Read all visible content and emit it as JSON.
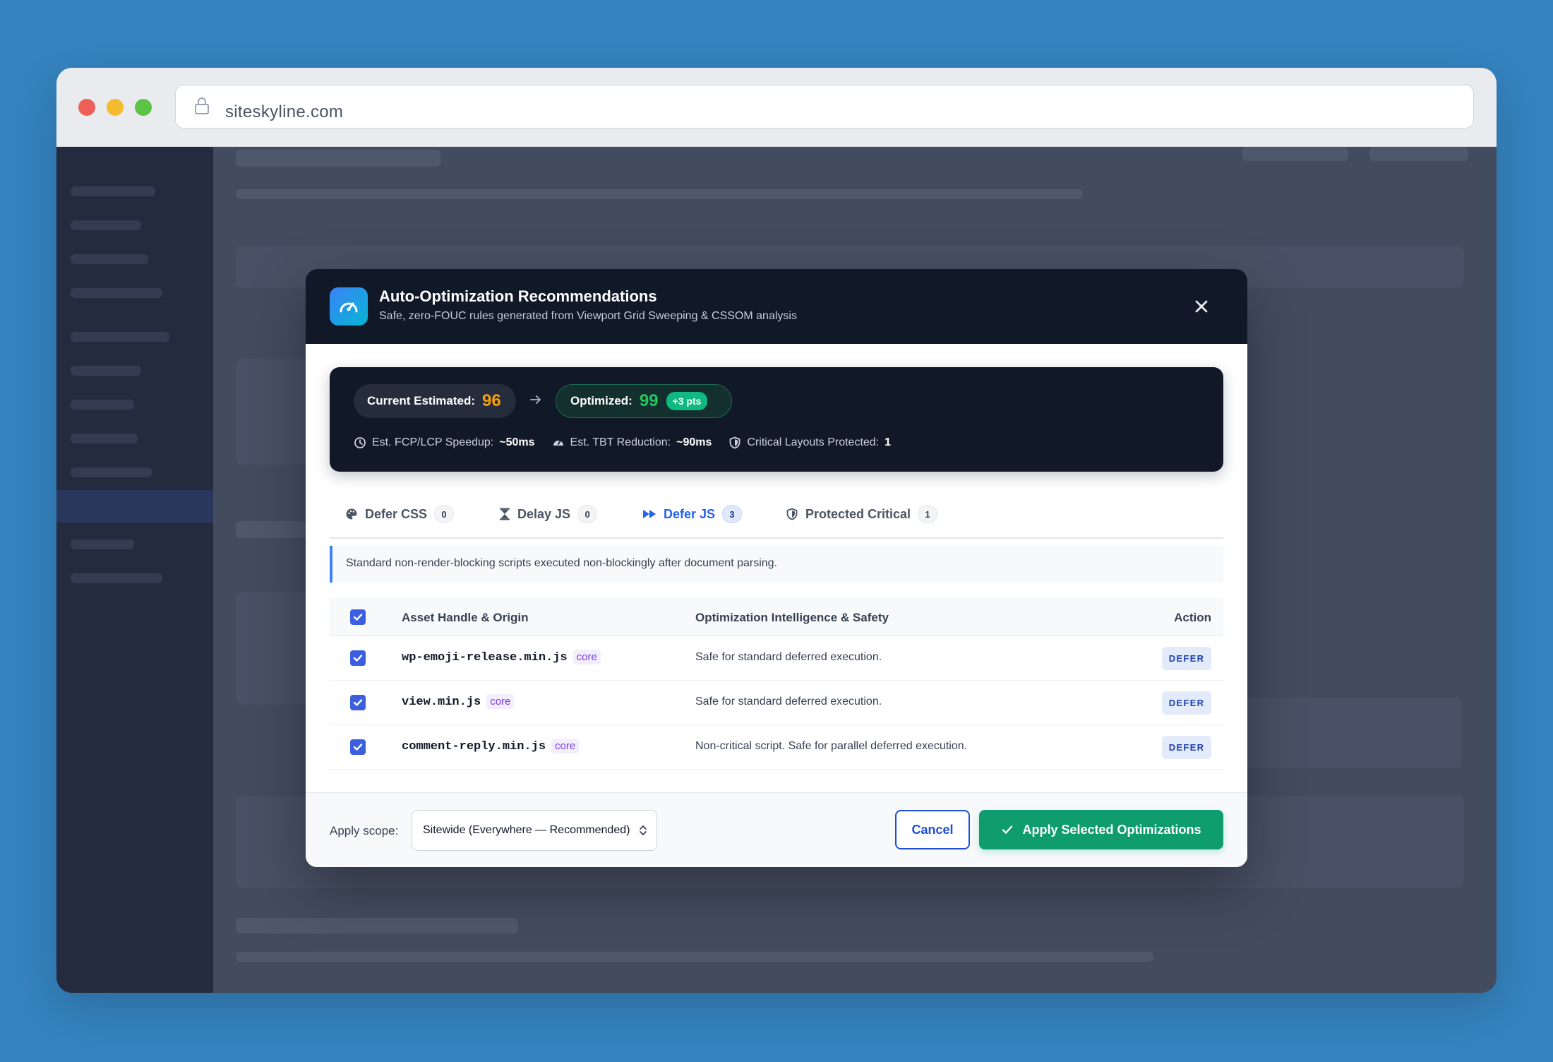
{
  "browser": {
    "url": "siteskyline.com"
  },
  "modal": {
    "title": "Auto-Optimization Recommendations",
    "subtitle": "Safe, zero-FOUC rules generated from Viewport Grid Sweeping & CSSOM analysis",
    "scores": {
      "current_label": "Current Estimated:",
      "current_value": "96",
      "optimized_label": "Optimized:",
      "optimized_value": "99",
      "delta": "+3 pts"
    },
    "metrics": [
      {
        "label": "Est. FCP/LCP Speedup:",
        "value": "~50ms"
      },
      {
        "label": "Est. TBT Reduction:",
        "value": "~90ms"
      },
      {
        "label": "Critical Layouts Protected:",
        "value": "1"
      }
    ],
    "tabs": [
      {
        "label": "Defer CSS",
        "count": "0",
        "active": false
      },
      {
        "label": "Delay JS",
        "count": "0",
        "active": false
      },
      {
        "label": "Defer JS",
        "count": "3",
        "active": true
      },
      {
        "label": "Protected Critical",
        "count": "1",
        "active": false
      }
    ],
    "info_text": "Standard non-render-blocking scripts executed non-blockingly after document parsing.",
    "table": {
      "headers": {
        "asset": "Asset Handle & Origin",
        "intel": "Optimization Intelligence & Safety",
        "action": "Action"
      },
      "rows": [
        {
          "handle": "wp-emoji-release.min.js",
          "origin": "core",
          "intel": "Safe for standard deferred execution.",
          "action": "DEFER",
          "checked": true
        },
        {
          "handle": "view.min.js",
          "origin": "core",
          "intel": "Safe for standard deferred execution.",
          "action": "DEFER",
          "checked": true
        },
        {
          "handle": "comment-reply.min.js",
          "origin": "core",
          "intel": "Non-critical script. Safe for parallel deferred execution.",
          "action": "DEFER",
          "checked": true
        }
      ]
    },
    "footer": {
      "scope_label": "Apply scope:",
      "scope_value": "Sitewide (Everywhere — Recommended)",
      "cancel": "Cancel",
      "apply": "Apply Selected Optimizations"
    }
  },
  "colors": {
    "page_bg": "#3583bf",
    "modal_header": "#111827",
    "accent_blue": "#2563eb",
    "current_score": "#f59e0b",
    "optimized_score": "#22c55e",
    "apply_green": "#0f9d6e",
    "origin_purple": "#7c3aed"
  },
  "icons": {
    "app": "speedometer-icon",
    "close": "close-icon",
    "tab_defer_css": "palette-icon",
    "tab_delay_js": "hourglass-icon",
    "tab_defer_js": "fast-forward-icon",
    "tab_protected": "shield-icon",
    "apply": "check-icon"
  }
}
